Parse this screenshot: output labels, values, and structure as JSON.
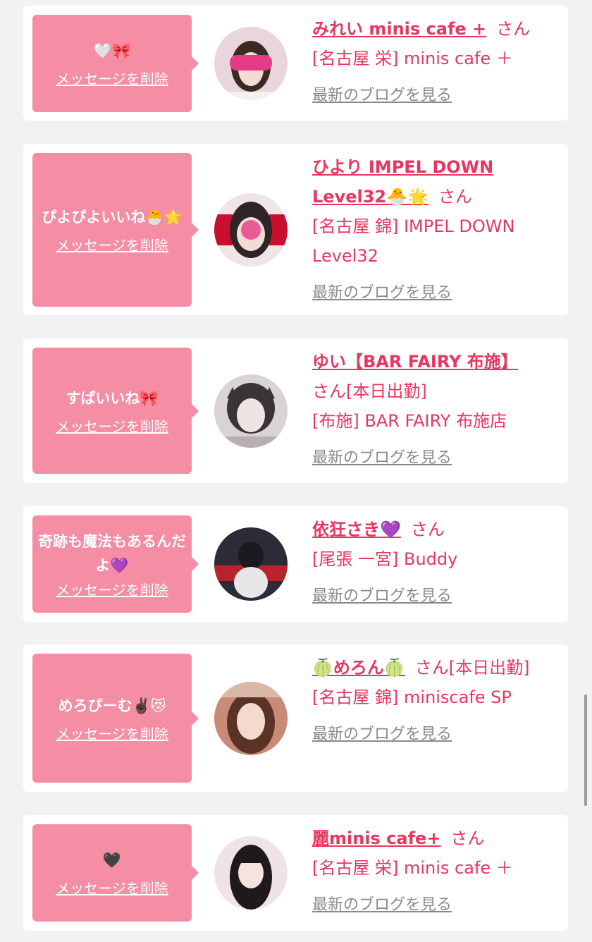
{
  "cards": [
    {
      "message": "🤍🎀",
      "delete_label": "メッセージを削除",
      "name": "みれい minis cafe +",
      "san": "さん",
      "shop": "[名古屋 栄] minis cafe ＋",
      "blog_label": "最新のブログを見る",
      "avatar_colors": [
        "#e9d5dc",
        "#3b2a24"
      ]
    },
    {
      "message": "ぴよぴよいいね🐣🌟",
      "delete_label": "メッセージを削除",
      "name": "ひより IMPEL DOWN Level32🐣🌟",
      "san": "さん",
      "shop": "[名古屋 錦] IMPEL DOWN Level32",
      "blog_label": "最新のブログを見る",
      "avatar_colors": [
        "#efe5e6",
        "#2f2528"
      ]
    },
    {
      "message": "すぱいいね🎀",
      "delete_label": "メッセージを削除",
      "name": "ゆい【BAR FAIRY 布施】",
      "san": "さん[本日出勤]",
      "shop": "[布施] BAR FAIRY 布施店",
      "blog_label": "最新のブログを見る",
      "avatar_colors": [
        "#d9d3d6",
        "#3a3437"
      ]
    },
    {
      "message": "奇跡も魔法もあるんだよ💜",
      "delete_label": "メッセージを削除",
      "name": "依狂さき💜",
      "san": "さん",
      "shop": "[尾張 一宮] Buddy",
      "blog_label": "最新のブログを見る",
      "avatar_colors": [
        "#2d2b38",
        "#b7242f"
      ]
    },
    {
      "message": "めろぴーむ✌🏿😻",
      "delete_label": "メッセージを削除",
      "name": "🍈めろん🍈",
      "san": "さん[本日出勤]",
      "shop": "[名古屋 錦] miniscafe SP",
      "blog_label": "最新のブログを見る",
      "avatar_colors": [
        "#c98a76",
        "#5b3326"
      ]
    },
    {
      "message": "🖤",
      "delete_label": "メッセージを削除",
      "name": "麗minis cafe+",
      "san": "さん",
      "shop": "[名古屋 栄] minis cafe ＋",
      "blog_label": "最新のブログを見る",
      "avatar_colors": [
        "#efe3e6",
        "#1e1a1c"
      ]
    }
  ]
}
